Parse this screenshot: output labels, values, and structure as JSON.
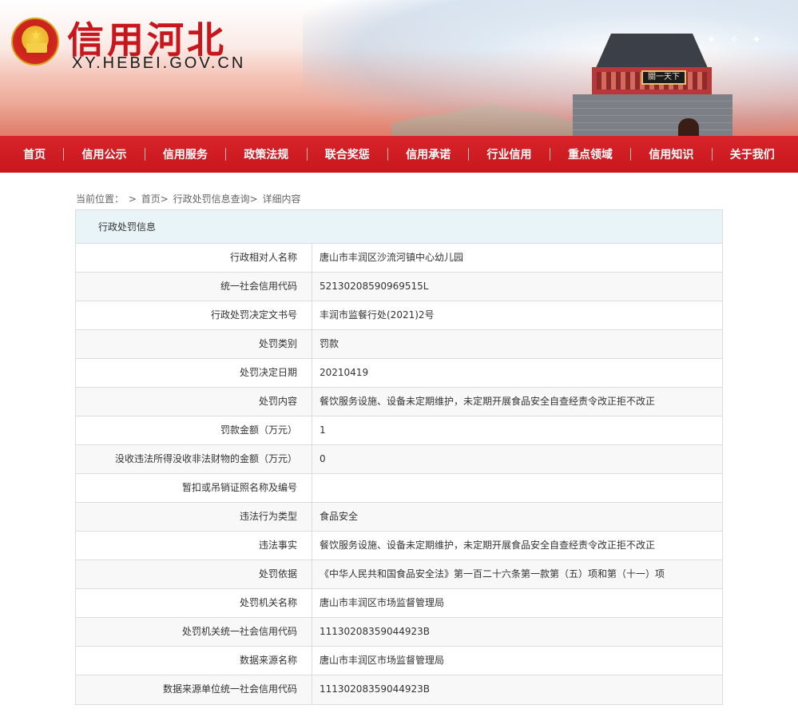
{
  "header": {
    "title": "信用河北",
    "subtitle": "XY.HEBEI.GOV.CN",
    "tower_sign": "關一天下"
  },
  "nav": {
    "items": [
      "首页",
      "信用公示",
      "信用服务",
      "政策法规",
      "联合奖惩",
      "信用承诺",
      "行业信用",
      "重点领域",
      "信用知识",
      "关于我们"
    ]
  },
  "breadcrumb": {
    "label": "当前位置：",
    "sep": ">",
    "home": "首页>",
    "query": "行政处罚信息查询>",
    "current": "详细内容"
  },
  "panel": {
    "title": "行政处罚信息",
    "rows": [
      {
        "label": "行政相对人名称",
        "value": "唐山市丰润区沙流河镇中心幼儿园"
      },
      {
        "label": "统一社会信用代码",
        "value": "52130208590969515L"
      },
      {
        "label": "行政处罚决定文书号",
        "value": "丰润市监餐行处(2021)2号"
      },
      {
        "label": "处罚类别",
        "value": "罚款"
      },
      {
        "label": "处罚决定日期",
        "value": "20210419"
      },
      {
        "label": "处罚内容",
        "value": "餐饮服务设施、设备未定期维护，未定期开展食品安全自查经责令改正拒不改正"
      },
      {
        "label": "罚款金额（万元）",
        "value": "1"
      },
      {
        "label": "没收违法所得没收非法财物的金额（万元）",
        "value": "0"
      },
      {
        "label": "暂扣或吊销证照名称及编号",
        "value": ""
      },
      {
        "label": "违法行为类型",
        "value": "食品安全"
      },
      {
        "label": "违法事实",
        "value": "餐饮服务设施、设备未定期维护，未定期开展食品安全自查经责令改正拒不改正"
      },
      {
        "label": "处罚依据",
        "value": "《中华人民共和国食品安全法》第一百二十六条第一款第（五）项和第（十一）项"
      },
      {
        "label": "处罚机关名称",
        "value": "唐山市丰润区市场监督管理局"
      },
      {
        "label": "处罚机关统一社会信用代码",
        "value": "11130208359044923B"
      },
      {
        "label": "数据来源名称",
        "value": "唐山市丰润区市场监督管理局"
      },
      {
        "label": "数据来源单位统一社会信用代码",
        "value": "11130208359044923B"
      }
    ]
  },
  "colors": {
    "nav_red": "#c8161d",
    "panel_head_bg": "#e8f4f7",
    "border": "#dcdcdc"
  }
}
